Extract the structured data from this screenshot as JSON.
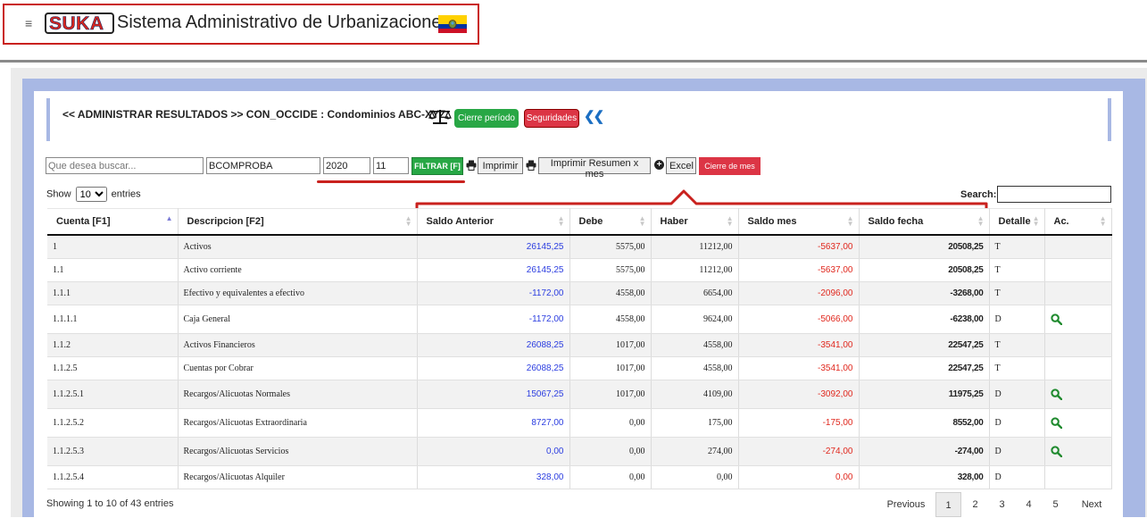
{
  "app": {
    "logo_text": "SUKA",
    "title": "Sistema Administrativo de Urbanizaciones",
    "menu_icon": "hamburger-icon",
    "flag_icon": "ecuador-flag-icon"
  },
  "header": {
    "title": "<< ADMINISTRAR RESULTADOS >> CON_OCCIDE : Condominios ABC-XYZ.",
    "scale_icon": "balance-scale-icon",
    "cierre_periodo": "Cierre período",
    "seguridades": "Seguridades",
    "back_icon": "double-chevron-left-icon"
  },
  "toolbar": {
    "search_placeholder": "Que desea buscar...",
    "table_value": "BCOMPROBA",
    "year_value": "2020",
    "month_value": "11",
    "filter_label": "FILTRAR [F]",
    "print_label": "Imprimir",
    "print_summary_label": "Imprimir Resumen x mes",
    "excel_label": "Excel",
    "close_month_label": "Cierre de mes"
  },
  "list_controls": {
    "show_label": "Show",
    "entries_value": "10",
    "entries_label": "entries",
    "search_label": "Search:"
  },
  "columns": [
    "Cuenta [F1]",
    "Descripcion [F2]",
    "Saldo Anterior",
    "Debe",
    "Haber",
    "Saldo mes",
    "Saldo fecha",
    "Detalle",
    "Ac."
  ],
  "rows": [
    {
      "cuenta": "1",
      "descripcion": "Activos",
      "saldo_anterior": "26145,25",
      "debe": "5575,00",
      "haber": "11212,00",
      "saldo_mes": "-5637,00",
      "saldo_fecha": "20508,25",
      "detalle": "T",
      "action": false
    },
    {
      "cuenta": "1.1",
      "descripcion": "Activo corriente",
      "saldo_anterior": "26145,25",
      "debe": "5575,00",
      "haber": "11212,00",
      "saldo_mes": "-5637,00",
      "saldo_fecha": "20508,25",
      "detalle": "T",
      "action": false
    },
    {
      "cuenta": "1.1.1",
      "descripcion": "Efectivo y equivalentes a efectivo",
      "saldo_anterior": "-1172,00",
      "debe": "4558,00",
      "haber": "6654,00",
      "saldo_mes": "-2096,00",
      "saldo_fecha": "-3268,00",
      "detalle": "T",
      "action": false
    },
    {
      "cuenta": "1.1.1.1",
      "descripcion": "Caja General",
      "saldo_anterior": "-1172,00",
      "debe": "4558,00",
      "haber": "9624,00",
      "saldo_mes": "-5066,00",
      "saldo_fecha": "-6238,00",
      "detalle": "D",
      "action": true
    },
    {
      "cuenta": "1.1.2",
      "descripcion": "Activos Financieros",
      "saldo_anterior": "26088,25",
      "debe": "1017,00",
      "haber": "4558,00",
      "saldo_mes": "-3541,00",
      "saldo_fecha": "22547,25",
      "detalle": "T",
      "action": false
    },
    {
      "cuenta": "1.1.2.5",
      "descripcion": "Cuentas por Cobrar",
      "saldo_anterior": "26088,25",
      "debe": "1017,00",
      "haber": "4558,00",
      "saldo_mes": "-3541,00",
      "saldo_fecha": "22547,25",
      "detalle": "T",
      "action": false
    },
    {
      "cuenta": "1.1.2.5.1",
      "descripcion": "Recargos/Alicuotas Normales",
      "saldo_anterior": "15067,25",
      "debe": "1017,00",
      "haber": "4109,00",
      "saldo_mes": "-3092,00",
      "saldo_fecha": "11975,25",
      "detalle": "D",
      "action": true
    },
    {
      "cuenta": "1.1.2.5.2",
      "descripcion": "Recargos/Alicuotas Extraordinaria",
      "saldo_anterior": "8727,00",
      "debe": "0,00",
      "haber": "175,00",
      "saldo_mes": "-175,00",
      "saldo_fecha": "8552,00",
      "detalle": "D",
      "action": true
    },
    {
      "cuenta": "1.1.2.5.3",
      "descripcion": "Recargos/Alicuotas Servicios",
      "saldo_anterior": "0,00",
      "debe": "0,00",
      "haber": "274,00",
      "saldo_mes": "-274,00",
      "saldo_fecha": "-274,00",
      "detalle": "D",
      "action": true
    },
    {
      "cuenta": "1.1.2.5.4",
      "descripcion": "Recargos/Alicuotas Alquiler",
      "saldo_anterior": "328,00",
      "debe": "0,00",
      "haber": "0,00",
      "saldo_mes": "0,00",
      "saldo_fecha": "328,00",
      "detalle": "D",
      "action": false
    }
  ],
  "footer": {
    "info": "Showing 1 to 10 of 43 entries",
    "previous": "Previous",
    "pages": [
      "1",
      "2",
      "3",
      "4",
      "5"
    ],
    "next": "Next"
  },
  "colors": {
    "accent_red": "#dc3545",
    "accent_green": "#28a745",
    "frame_blue": "#a8b8e4",
    "value_blue": "#2b3de0",
    "value_red": "#e0281e"
  }
}
